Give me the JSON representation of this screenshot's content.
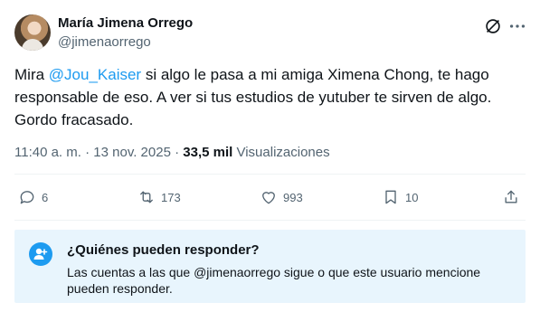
{
  "author": {
    "name": "María Jimena Orrego",
    "handle": "@jimenaorrego"
  },
  "tweet": {
    "text_before": "Mira ",
    "mention": "@Jou_Kaiser",
    "text_after": " si algo le pasa a mi amiga Ximena Chong, te hago responsable de eso. A ver si tus estudios de yutuber te sirven de algo. Gordo fracasado."
  },
  "meta": {
    "time": "11:40 a. m.",
    "sep1": " · ",
    "date": "13 nov. 2025",
    "sep2": " · ",
    "views_count": "33,5 mil",
    "views_label": " Visualizaciones"
  },
  "actions": {
    "replies": "6",
    "reposts": "173",
    "likes": "993",
    "bookmarks": "10"
  },
  "reply_restriction": {
    "title": "¿Quiénes pueden responder?",
    "description": "Las cuentas a las que @jimenaorrego sigue o que este usuario mencione pueden responder."
  },
  "colors": {
    "accent": "#1d9bf0",
    "secondary_text": "#536471",
    "reply_box_bg": "#e8f5fd"
  },
  "icons": [
    "grok-icon",
    "more-icon",
    "reply-icon",
    "repost-icon",
    "like-icon",
    "bookmark-icon",
    "share-icon",
    "people-icon"
  ]
}
